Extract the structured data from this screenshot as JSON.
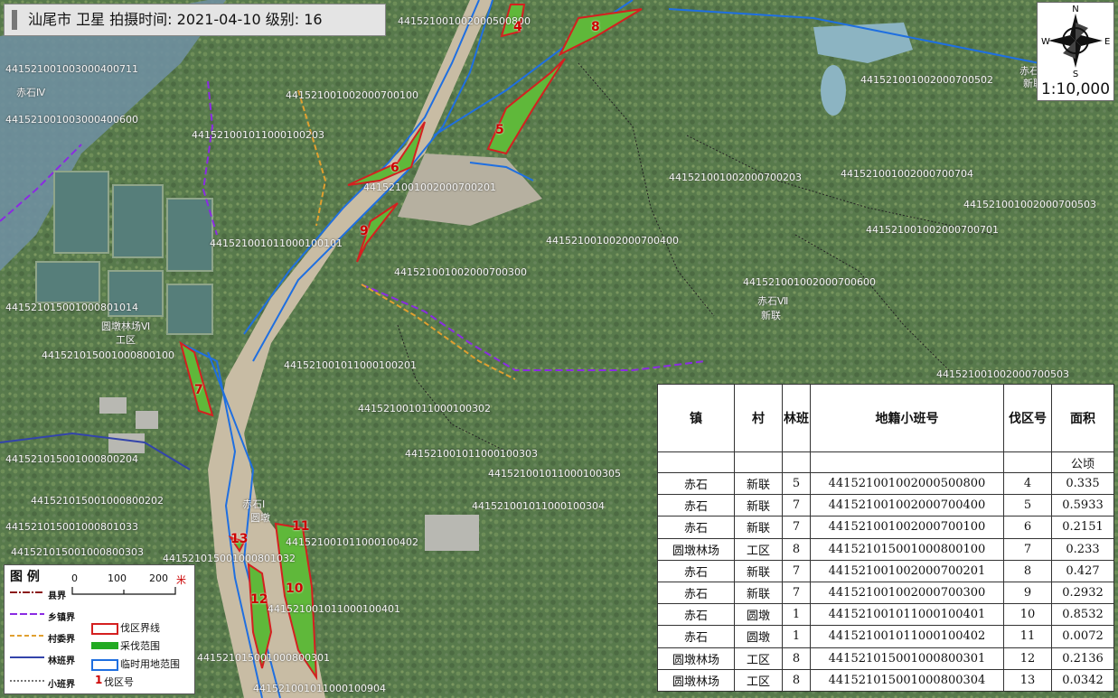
{
  "title": "汕尾市 卫星   拍摄时间: 2021-04-10   级别: 16",
  "compass": {
    "n": "N",
    "s": "S",
    "e": "E",
    "w": "W",
    "scale": "1:10,000"
  },
  "map_labels": [
    "赤石Ⅳ",
    "赤石Ⅶ",
    "新联",
    "赤石Ⅰ",
    "圆墩",
    "圆墩林场Ⅵ",
    "工区",
    "赤石",
    "新联"
  ],
  "parcel_ids": [
    "441521001002000500800",
    "441521001003000400711",
    "441521001002000700100",
    "441521001002000700300",
    "441521001002000700400",
    "441521001011000100101",
    "441521001002000700203",
    "441521001002000700201",
    "441521001002000700502",
    "441521001002000700704",
    "441521001002000700503",
    "441521001002000700701",
    "441521001002000700600",
    "441521001002000700503",
    "441521015001000801014",
    "441521015001000800100",
    "441521001011000100201",
    "441521001011000100302",
    "441521001011000100303",
    "441521001011000100305",
    "441521001011000100304",
    "441521015001000800204",
    "441521015001000800202",
    "441521015001000801033",
    "441521001011000100402",
    "441521001011000100401",
    "441521015001000800301",
    "441521001011000100904",
    "441521001003000400600",
    "441521001011000100203",
    "441521015001000800303",
    "441521015001000801032"
  ],
  "cut_numbers": [
    "4",
    "8",
    "5",
    "6",
    "9",
    "7",
    "11",
    "13",
    "10",
    "12"
  ],
  "legend": {
    "title": "图 例",
    "items": [
      "县界",
      "乡镇界",
      "村委界",
      "林班界",
      "小班界"
    ],
    "symbols": [
      "伐区界线",
      "采伐范围",
      "临时用地范围",
      "伐区号"
    ],
    "cut_num_sample": "1",
    "scale": {
      "zero": "0",
      "mid": "100",
      "end": "200",
      "unit": "米"
    },
    "colors": {
      "county": "#8b1a1a",
      "town": "#8a2be2",
      "village": "#e0a030",
      "forest": "#3344aa",
      "sub": "#222222",
      "cut": "#d42020",
      "range": "#22aa22",
      "temp": "#1f6fe0"
    }
  },
  "table": {
    "headers": [
      "镇",
      "村",
      "林班",
      "地籍小班号",
      "伐区号",
      "面积"
    ],
    "unit": "公顷",
    "rows": [
      [
        "赤石",
        "新联",
        "5",
        "441521001002000500800",
        "4",
        "0.335"
      ],
      [
        "赤石",
        "新联",
        "7",
        "441521001002000700400",
        "5",
        "0.5933"
      ],
      [
        "赤石",
        "新联",
        "7",
        "441521001002000700100",
        "6",
        "0.2151"
      ],
      [
        "圆墩林场",
        "工区",
        "8",
        "441521015001000800100",
        "7",
        "0.233"
      ],
      [
        "赤石",
        "新联",
        "7",
        "441521001002000700201",
        "8",
        "0.427"
      ],
      [
        "赤石",
        "新联",
        "7",
        "441521001002000700300",
        "9",
        "0.2932"
      ],
      [
        "赤石",
        "圆墩",
        "1",
        "441521001011000100401",
        "10",
        "0.8532"
      ],
      [
        "赤石",
        "圆墩",
        "1",
        "441521001011000100402",
        "11",
        "0.0072"
      ],
      [
        "圆墩林场",
        "工区",
        "8",
        "441521015001000800301",
        "12",
        "0.2136"
      ],
      [
        "圆墩林场",
        "工区",
        "8",
        "441521015001000800304",
        "13",
        "0.0342"
      ]
    ]
  }
}
